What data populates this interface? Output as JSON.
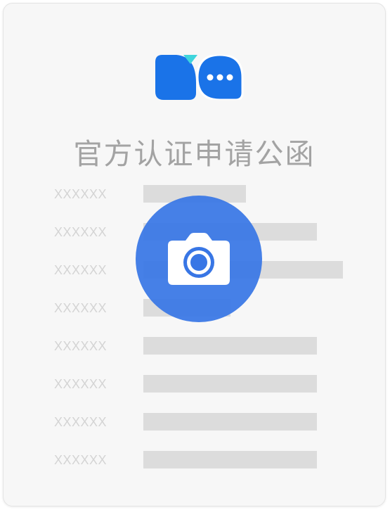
{
  "title": "官方认证申请公函",
  "rows": [
    {
      "label": "XXXXXX",
      "fill": 0.59
    },
    {
      "label": "XXXXXX",
      "fill": 1.0
    },
    {
      "label": "XXXXXX",
      "fill": 1.15
    },
    {
      "label": "XXXXXX",
      "fill": 0.5
    },
    {
      "label": "XXXXXX",
      "fill": 1.0
    },
    {
      "label": "XXXXXX",
      "fill": 1.0
    },
    {
      "label": "XXXXXX",
      "fill": 1.0
    },
    {
      "label": "XXXXXX",
      "fill": 1.0
    }
  ],
  "icons": {
    "logo": "chat-bubble-logo-icon",
    "upload": "camera-icon"
  },
  "colors": {
    "brand_blue": "#1a73e8",
    "logo_accent": "#3fd5dc",
    "camera_button": "#3876e5",
    "title_text": "#a3a3a3",
    "placeholder_bar": "#dcdcdc"
  }
}
